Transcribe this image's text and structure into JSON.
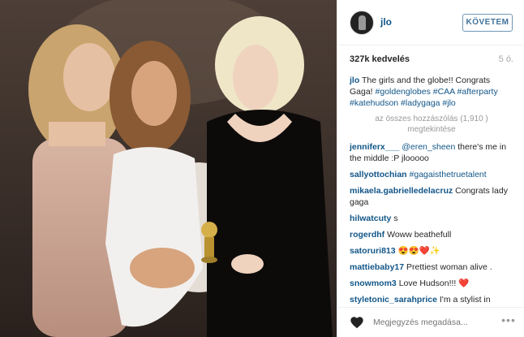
{
  "post": {
    "username": "jlo",
    "follow_label": "KÖVETEM",
    "likes": "327k kedvelés",
    "time_ago": "5 ó."
  },
  "caption": {
    "username": "jlo",
    "text": "The girls and the globe!! Congrats Gaga!",
    "hashtags": "#goldenglobes #CAA #afterparty #katehudson #ladygaga #jlo"
  },
  "load_more": "az összes hozzászólás (1,910 ) megtekintése",
  "comments": [
    {
      "user": "jenniferx___",
      "text_tag": "@eren_sheen",
      "text": " there's me in the middle :P jlooooo"
    },
    {
      "user": "sallyottochian",
      "text_tag": "#gagaisthetruetalent",
      "text": ""
    },
    {
      "user": "mikaela.gabrielledelacruz",
      "text_tag": "",
      "text": "Congrats lady gaga"
    },
    {
      "user": "hilwatcuty",
      "text_tag": "",
      "text": "s"
    },
    {
      "user": "rogerdhf",
      "text_tag": "",
      "text": "Woww beathefull"
    },
    {
      "user": "satoruri813",
      "text_tag": "",
      "text": "😍😍❤️✨"
    },
    {
      "user": "mattiebaby17",
      "text_tag": "",
      "text": "Prettiest woman alive ."
    },
    {
      "user": "snowmom3",
      "text_tag": "",
      "text": "Love Hudson!!! ❤️"
    },
    {
      "user": "styletonic_sarahprice",
      "text_tag": "",
      "text": "I'm a stylist in London, I know diva when I see it - love!!"
    }
  ],
  "footer": {
    "comment_placeholder": "Megjegyzés megadása...",
    "more": "•••"
  },
  "icons": {
    "like": "heart-icon",
    "more": "ellipsis-icon"
  }
}
